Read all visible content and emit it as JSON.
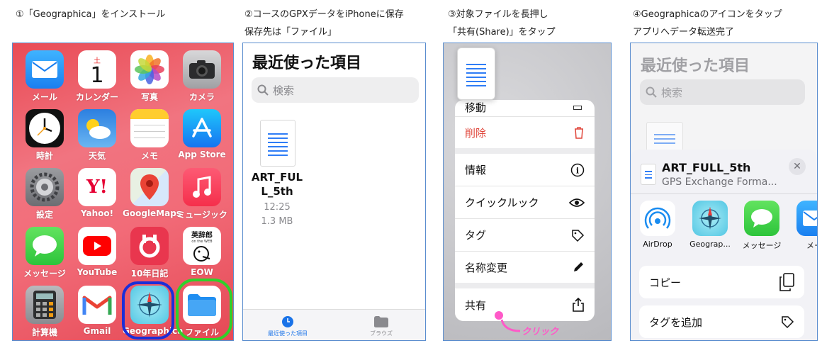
{
  "captions": {
    "step1": "①「Geographica」をインストール",
    "step2_line1": "②コースのGPXデータをiPhoneに保存",
    "step2_line2": "保存先は「ファイル」",
    "step3_line1": "③対象ファイルを長押し",
    "step3_line2": "「共有(Share)」をタップ",
    "step4_line1": "④Geographicaのアイコンをタップ",
    "step4_line2": "アプリへデータ転送完了"
  },
  "home": {
    "calendar_day": "土",
    "calendar_date": "1",
    "yahoo_mark": "Y!",
    "eow_mark": "英辞郎",
    "eow_small": "on the WEB",
    "apps": [
      {
        "label": "メール"
      },
      {
        "label": "カレンダー"
      },
      {
        "label": "写真"
      },
      {
        "label": "カメラ"
      },
      {
        "label": "時計"
      },
      {
        "label": "天気"
      },
      {
        "label": "メモ"
      },
      {
        "label": "App Store"
      },
      {
        "label": "設定"
      },
      {
        "label": "Yahoo!"
      },
      {
        "label": "GoogleMaps"
      },
      {
        "label": "ミュージック"
      },
      {
        "label": "メッセージ"
      },
      {
        "label": "YouTube"
      },
      {
        "label": "10年日記"
      },
      {
        "label": "EOW"
      },
      {
        "label": "計算機"
      },
      {
        "label": "Gmail"
      },
      {
        "label": "Geographica"
      },
      {
        "label": "ファイル"
      }
    ]
  },
  "files": {
    "title": "最近使った項目",
    "search_placeholder": "検索",
    "file_name_line1": "ART_FUL",
    "file_name_line2": "L_5th",
    "file_time": "12:25",
    "file_size": "1.3 MB",
    "tab_recent": "最近使った項目",
    "tab_browse": "ブラウズ"
  },
  "menu": {
    "items": [
      {
        "label": "移動"
      },
      {
        "label": "削除"
      },
      {
        "label": "情報"
      },
      {
        "label": "クイックルック"
      },
      {
        "label": "タグ"
      },
      {
        "label": "名称変更"
      },
      {
        "label": "共有"
      }
    ],
    "click_note": "クリック",
    "delete_color": "#e0453a"
  },
  "share": {
    "title": "最近使った項目",
    "search_placeholder": "検索",
    "file_name": "ART_FULL_5th",
    "file_type": "GPS Exchange Forma...",
    "apps": [
      {
        "label": "AirDrop"
      },
      {
        "label": "Geograp..."
      },
      {
        "label": "メッセージ"
      },
      {
        "label": "メー"
      }
    ],
    "actions": [
      {
        "label": "コピー"
      },
      {
        "label": "タグを追加"
      }
    ]
  }
}
